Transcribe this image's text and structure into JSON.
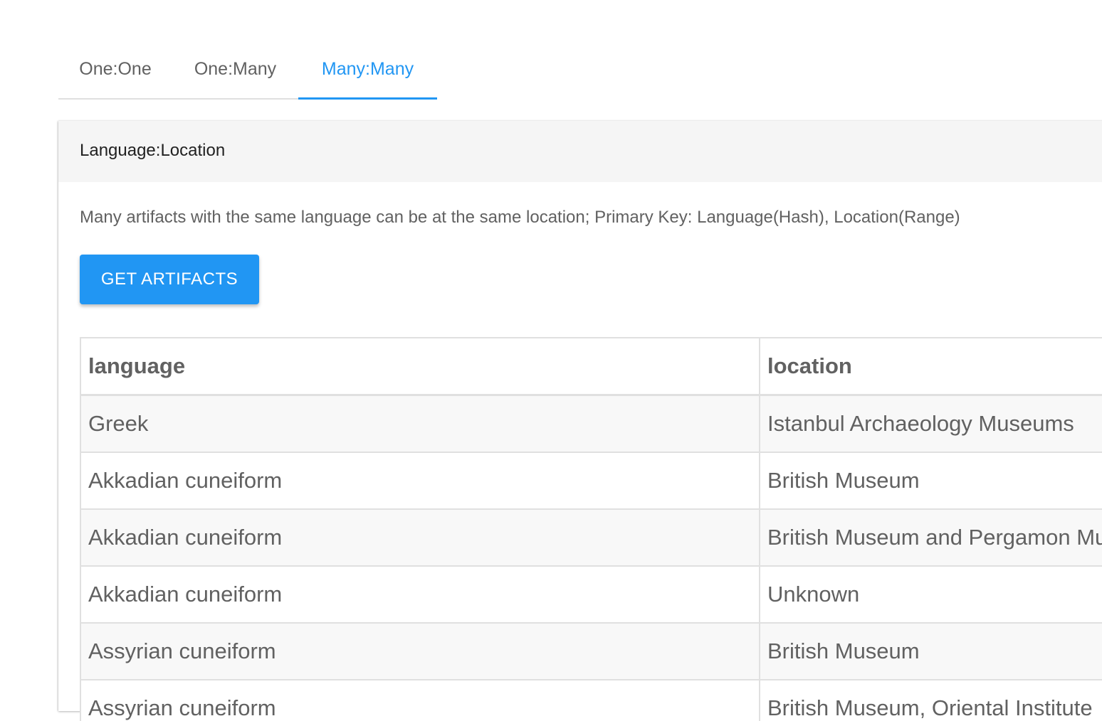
{
  "tabs": [
    {
      "label": "One:One"
    },
    {
      "label": "One:Many"
    },
    {
      "label": "Many:Many"
    }
  ],
  "active_tab": "Many:Many",
  "accent_color": "#2196f3",
  "card": {
    "title": "Language:Location",
    "description": "Many artifacts with the same language can be at the same location; Primary Key: Language(Hash), Location(Range)",
    "button_label": "GET ARTIFACTS"
  },
  "table": {
    "headers": [
      "language",
      "location"
    ],
    "rows": [
      [
        "Greek",
        "Istanbul Archaeology Museums"
      ],
      [
        "Akkadian cuneiform",
        "British Museum"
      ],
      [
        "Akkadian cuneiform",
        "British Museum and Pergamon Museum"
      ],
      [
        "Akkadian cuneiform",
        "Unknown"
      ],
      [
        "Assyrian cuneiform",
        "British Museum"
      ],
      [
        "Assyrian cuneiform",
        "British Museum, Oriental Institute"
      ]
    ]
  }
}
